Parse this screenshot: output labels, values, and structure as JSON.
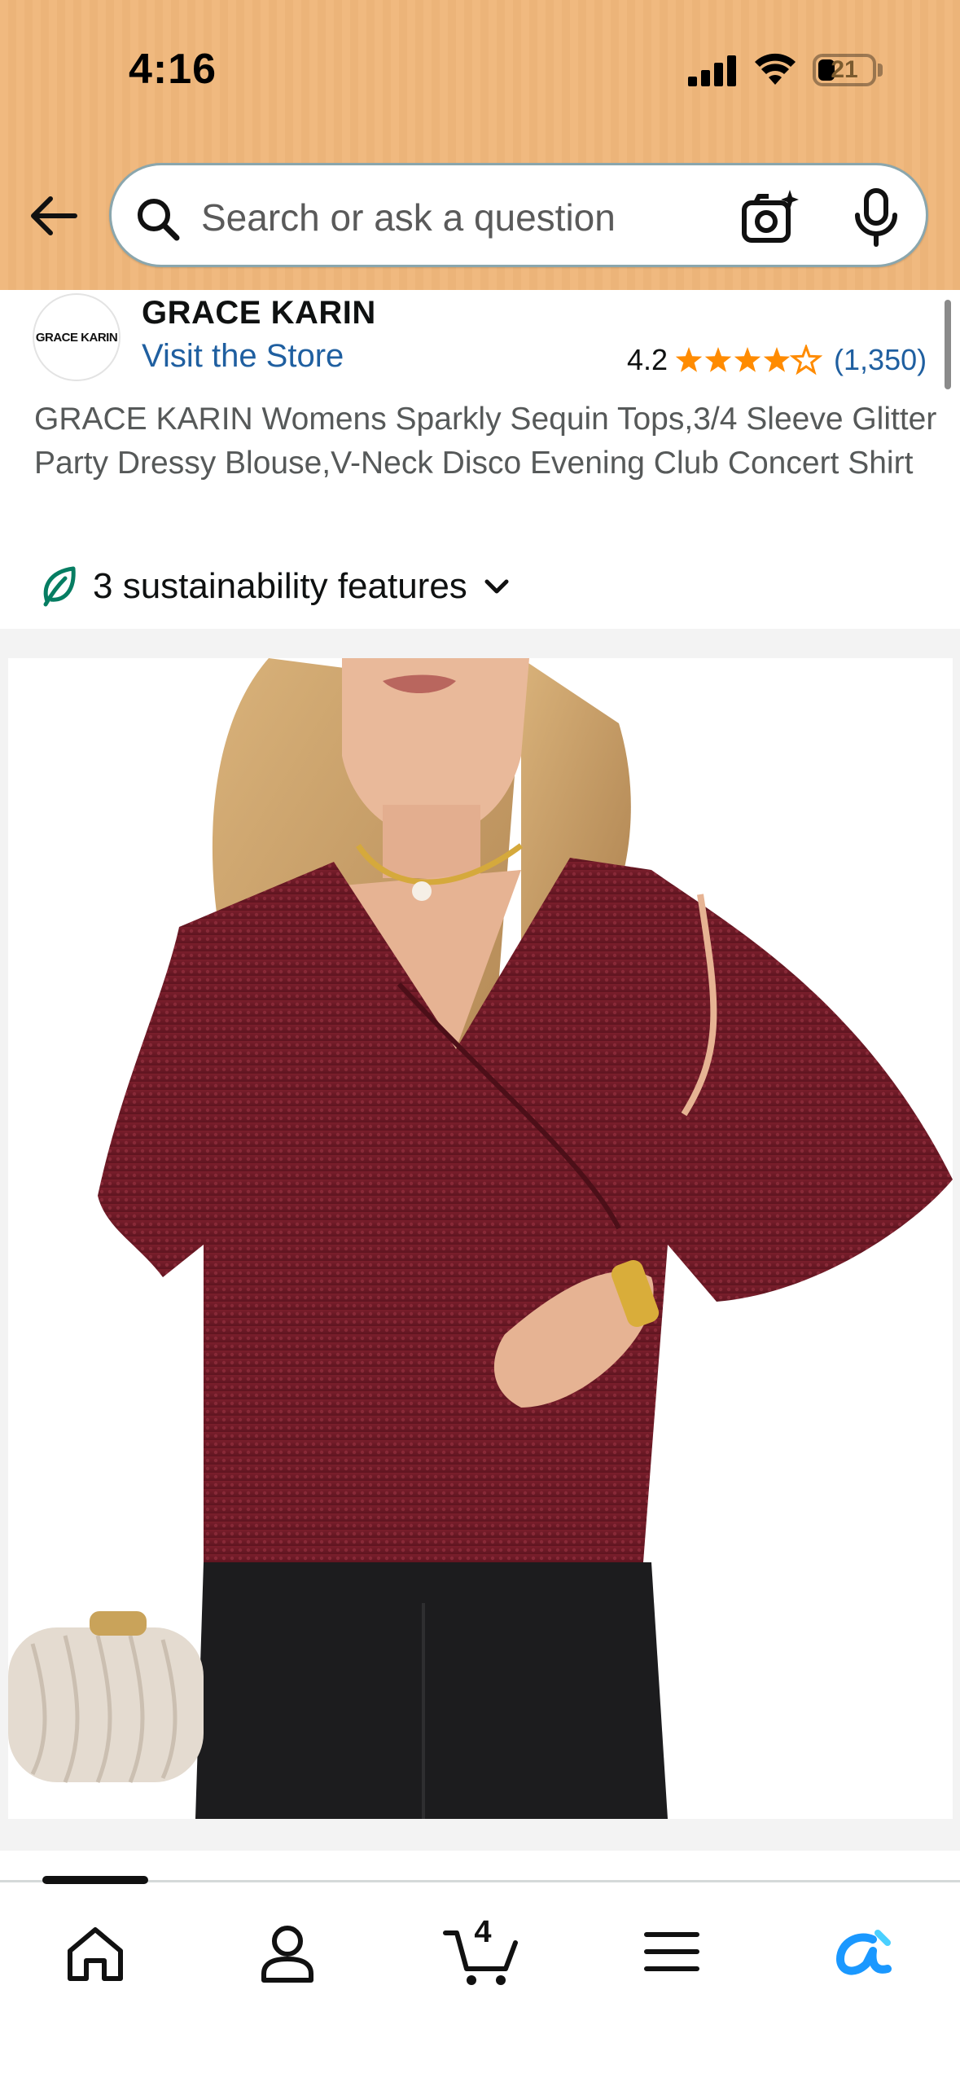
{
  "status_bar": {
    "time": "4:16",
    "battery_level": "21"
  },
  "search": {
    "placeholder": "Search or ask a question",
    "value": ""
  },
  "brand": {
    "logo_text": "GRACE KARIN",
    "name": "GRACE KARIN",
    "store_link": "Visit the Store"
  },
  "rating": {
    "value": "4.2",
    "stars_filled": 4,
    "stars_total": 5,
    "review_count": "(1,350)"
  },
  "product": {
    "title": "GRACE KARIN Womens Sparkly Sequin Tops,3/4 Sleeve Glitter Party Dressy Blouse,V-Neck Disco Evening Club Concert Shirt"
  },
  "sustainability": {
    "label": "3 sustainability features"
  },
  "bottom_nav": {
    "items": [
      "home-icon",
      "account-icon",
      "cart-icon",
      "menu-icon",
      "rufus-icon"
    ],
    "cart_count": "4"
  },
  "colors": {
    "header_bg": "#f0b97f",
    "link": "#1f5fa0",
    "star": "#ff8b00",
    "sustainability_leaf": "#067d62",
    "rufus_accent": "#1a98ff"
  }
}
